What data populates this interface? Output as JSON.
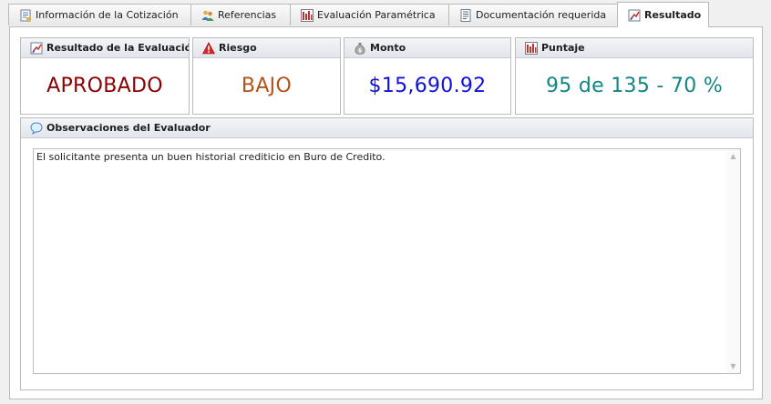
{
  "tabs": [
    {
      "label": "Información de la Cotización",
      "icon": "form-icon"
    },
    {
      "label": "Referencias",
      "icon": "people-icon"
    },
    {
      "label": "Evaluación Paramétrica",
      "icon": "bar-chart-icon"
    },
    {
      "label": "Documentación requerida",
      "icon": "document-icon"
    },
    {
      "label": "Resultado",
      "icon": "evaluation-icon",
      "active": true
    }
  ],
  "cards": {
    "resultado": {
      "title": "Resultado de la Evaluació",
      "value": "APROBADO",
      "color": "#8b0000",
      "icon": "evaluation-icon"
    },
    "riesgo": {
      "title": "Riesgo",
      "value": "BAJO",
      "color": "#b5541a",
      "icon": "warning-icon"
    },
    "monto": {
      "title": "Monto",
      "value": "$15,690.92",
      "color": "#1010e0",
      "icon": "money-bag-icon"
    },
    "puntaje": {
      "title": "Puntaje",
      "value": "95 de 135 - 70 %",
      "color": "#128585",
      "icon": "bar-chart-icon"
    }
  },
  "observaciones": {
    "title": "Observaciones del Evaluador",
    "icon": "speech-bubble-icon",
    "text": "El solicitante presenta un buen historial crediticio en Buro de Credito."
  }
}
